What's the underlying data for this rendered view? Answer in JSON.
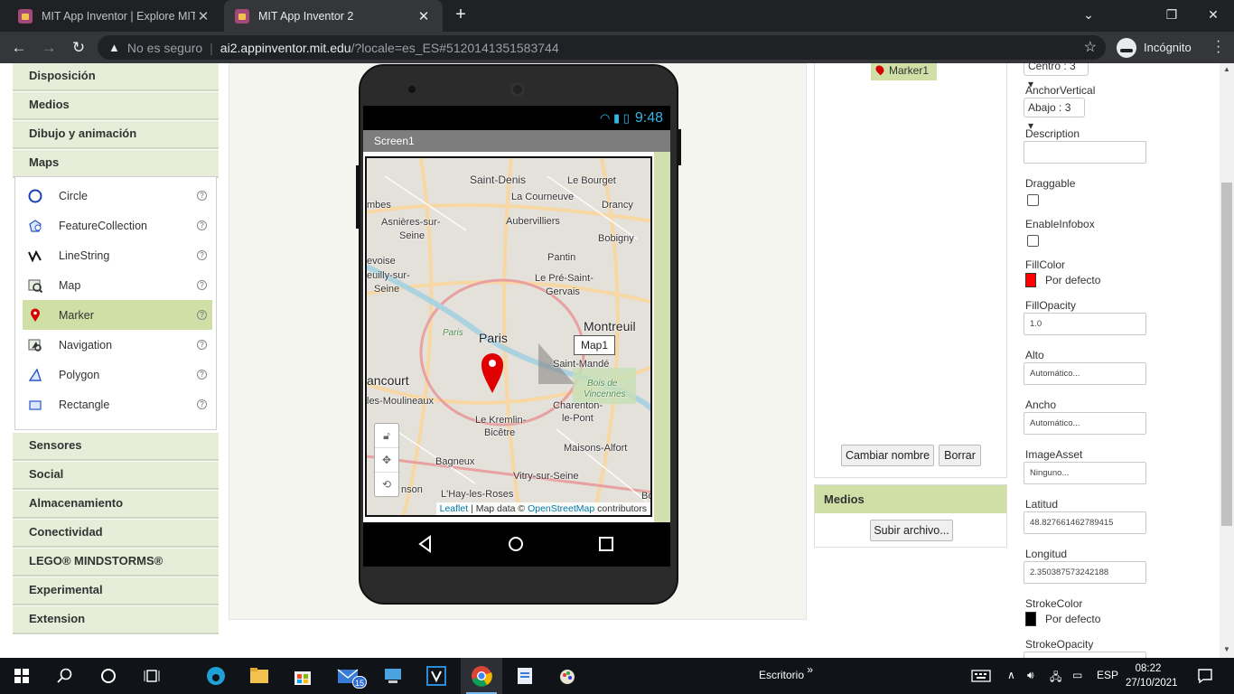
{
  "browser": {
    "tabs": [
      {
        "title": "MIT App Inventor | Explore MIT A",
        "active": false
      },
      {
        "title": "MIT App Inventor 2",
        "active": true
      }
    ],
    "new_tab": "+",
    "window_controls": {
      "minimize": "⌄",
      "restore": "❐",
      "close": "✕"
    },
    "address": {
      "security_label": "No es seguro",
      "host": "ai2.appinventor.mit.edu",
      "path": "/?locale=es_ES#5120141351583744"
    },
    "profile_label": "Incógnito"
  },
  "palette": {
    "categories_top": [
      "Disposición",
      "Medios",
      "Dibujo y animación",
      "Maps"
    ],
    "maps_items": [
      {
        "label": "Circle",
        "icon": "circle-icon"
      },
      {
        "label": "FeatureCollection",
        "icon": "feature-collection-icon"
      },
      {
        "label": "LineString",
        "icon": "linestring-icon"
      },
      {
        "label": "Map",
        "icon": "map-icon"
      },
      {
        "label": "Marker",
        "icon": "marker-icon",
        "selected": true
      },
      {
        "label": "Navigation",
        "icon": "navigation-icon"
      },
      {
        "label": "Polygon",
        "icon": "polygon-icon"
      },
      {
        "label": "Rectangle",
        "icon": "rectangle-icon"
      }
    ],
    "help_glyph": "?",
    "categories_bottom": [
      "Sensores",
      "Social",
      "Almacenamiento",
      "Conectividad",
      "LEGO® MINDSTORMS®",
      "Experimental",
      "Extension"
    ]
  },
  "viewer": {
    "status_time": "9:48",
    "screen_title": "Screen1",
    "map": {
      "labels": {
        "saint_denis": "Saint-Denis",
        "le_bourget": "Le Bourget",
        "la_courneuve": "La Courneuve",
        "drancy": "Drancy",
        "asnieres": "Asnières-sur-",
        "seine_1": "Seine",
        "aubervilliers": "Aubervilliers",
        "bobigny": "Bobigny",
        "levois": "evoise",
        "neuilly": "euilly-sur-",
        "seine_2": "Seine",
        "pantin": "Pantin",
        "pre_saint": "Le Pré-Saint-",
        "gervais": "Gervais",
        "montreuil": "Montreuil",
        "paris": "Paris",
        "paris_small": "Paris",
        "saint_mande": "Saint-Mandé",
        "bois_1": "Bois de",
        "bois_2": "Vincennes",
        "ancourt": "ancourt",
        "moulineaux": "les-Moulineaux",
        "charenton": "Charenton-",
        "le_pont": "le-Pont",
        "kremlin": "Le Kremlin-",
        "bicetre": "Bicêtre",
        "maisons": "Maisons-Alfort",
        "bagneux": "Bagneux",
        "vitry": "Vitry-sur-Seine",
        "hay": "L'Hay-les-Roses",
        "bo": "Bo",
        "ombes": "mbes",
        "onson": "nson"
      },
      "tooltip": "Map1",
      "attribution": {
        "leaflet": "Leaflet",
        "middle": " | Map data © ",
        "osm": "OpenStreetMap",
        "tail": " contributors"
      }
    }
  },
  "components": {
    "tree_item": "Marker1",
    "rename_button": "Cambiar nombre",
    "delete_button": "Borrar"
  },
  "media": {
    "header": "Medios",
    "upload_button": "Subir archivo..."
  },
  "properties": {
    "anchor_horizontal_value": "Centro : 3",
    "anchor_vertical_label": "AnchorVertical",
    "anchor_vertical_value": "Abajo : 3",
    "description_label": "Description",
    "description_value": "",
    "draggable_label": "Draggable",
    "enable_infobox_label": "EnableInfobox",
    "fill_color_label": "FillColor",
    "fill_color_value": "Por defecto",
    "fill_color_swatch": "#ff0000",
    "fill_opacity_label": "FillOpacity",
    "fill_opacity_value": "1.0",
    "alto_label": "Alto",
    "alto_value": "Automático...",
    "ancho_label": "Ancho",
    "ancho_value": "Automático...",
    "image_asset_label": "ImageAsset",
    "image_asset_value": "Ninguno...",
    "latitud_label": "Latitud",
    "latitud_value": "48.827661462789415",
    "longitud_label": "Longitud",
    "longitud_value": "2.350387573242188",
    "stroke_color_label": "StrokeColor",
    "stroke_color_value": "Por defecto",
    "stroke_color_swatch": "#000000",
    "stroke_opacity_label": "StrokeOpacity"
  },
  "taskbar": {
    "mail_badge": "15",
    "desktop_label": "Escritorio",
    "desktop_chevron": "»",
    "language": "ESP",
    "time": "08:22",
    "date": "27/10/2021"
  }
}
